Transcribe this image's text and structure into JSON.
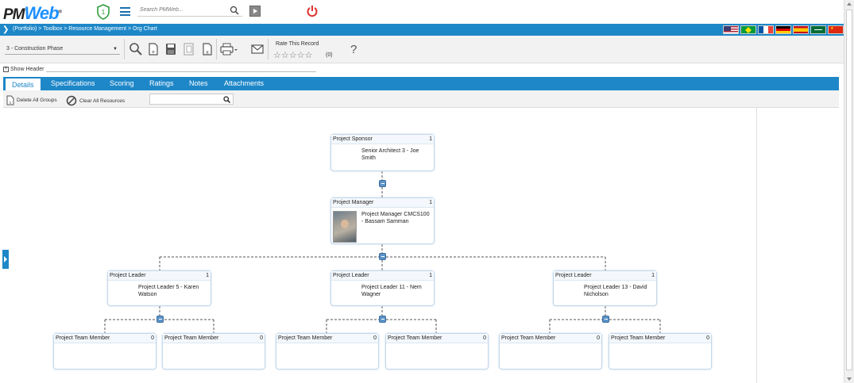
{
  "app": {
    "logo_main": "PM",
    "logo_accent": "Web",
    "logo_mark": "®",
    "notifications_count": "1",
    "search_placeholder": "Search PMWeb..."
  },
  "breadcrumb": "(Portfolio) > Toolbox > Resource Management > Org Chart",
  "flags": [
    {
      "name": "us-flag-icon",
      "color": "#b22234"
    },
    {
      "name": "brazil-flag-icon",
      "color": "#009c3b"
    },
    {
      "name": "france-flag-icon",
      "color": "#0055a4"
    },
    {
      "name": "germany-flag-icon",
      "color": "#000000"
    },
    {
      "name": "spain-flag-icon",
      "color": "#c60b1e"
    },
    {
      "name": "saudi-flag-icon",
      "color": "#006c35"
    },
    {
      "name": "china-flag-icon",
      "color": "#de2910"
    }
  ],
  "toolbar": {
    "phase_value": "3 - Construction Phase",
    "rate_label": "Rate This Record",
    "rating_stars": "☆☆☆☆☆",
    "rating_count": "(0)",
    "help": "?"
  },
  "show_header": "Show Header",
  "tabs": [
    "Details",
    "Specifications",
    "Scoring",
    "Ratings",
    "Notes",
    "Attachments"
  ],
  "subtoolbar": {
    "delete_groups": "Delete All Groups",
    "clear_resources": "Clear All Resources"
  },
  "org": {
    "sponsor": {
      "role": "Project Sponsor",
      "count": "1",
      "name": "Senior Architect 3 - Joe Smith"
    },
    "manager": {
      "role": "Project Manager",
      "count": "1",
      "name": "Project Manager CMCS100 - Bassam Samman"
    },
    "leaders": [
      {
        "role": "Project Leader",
        "count": "1",
        "name": "Project Leader 5 - Karen Watson"
      },
      {
        "role": "Project Leader",
        "count": "1",
        "name": "Project Leader 11 - Nem Wagner"
      },
      {
        "role": "Project Leader",
        "count": "1",
        "name": "Project Leader 13 - David Nicholson"
      }
    ],
    "members": [
      {
        "role": "Project Team Member",
        "count": "0"
      },
      {
        "role": "Project Team Member",
        "count": "0"
      },
      {
        "role": "Project Team Member",
        "count": "0"
      },
      {
        "role": "Project Team Member",
        "count": "0"
      },
      {
        "role": "Project Team Member",
        "count": "0"
      },
      {
        "role": "Project Team Member",
        "count": "0"
      }
    ]
  },
  "colors": {
    "brand_blue": "#1e87c8",
    "power_red": "#e03030",
    "shield_green": "#2e9d3a"
  }
}
